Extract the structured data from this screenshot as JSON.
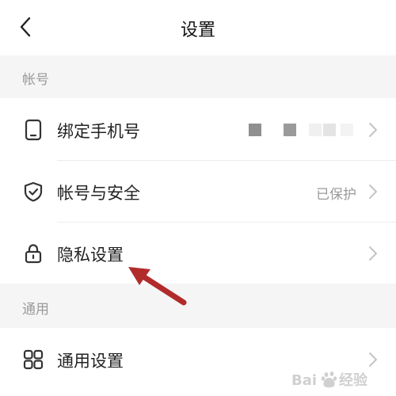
{
  "header": {
    "title": "设置",
    "back_icon": "chevron-left-icon"
  },
  "sections": {
    "account": {
      "label": "帐号",
      "items": [
        {
          "label": "绑定手机号",
          "icon": "phone-icon",
          "value": ""
        },
        {
          "label": "帐号与安全",
          "icon": "shield-check-icon",
          "value": "已保护"
        },
        {
          "label": "隐私设置",
          "icon": "lock-icon",
          "value": ""
        }
      ]
    },
    "general": {
      "label": "通用",
      "items": [
        {
          "label": "通用设置",
          "icon": "grid-icon",
          "value": ""
        }
      ]
    }
  },
  "annotation": {
    "icon": "red-arrow-icon",
    "color": "#b22b2b"
  },
  "watermark": {
    "text": "Baidu 经验"
  },
  "colors": {
    "background": "#f5f5f5",
    "card": "#ffffff",
    "secondary_text": "#9a9a9a",
    "chevron": "#c4c4c4"
  }
}
